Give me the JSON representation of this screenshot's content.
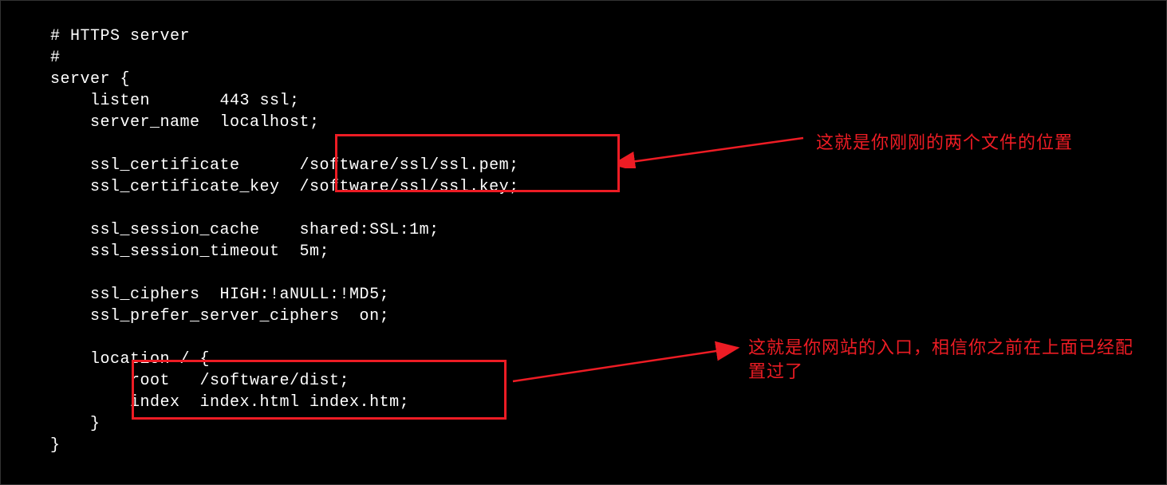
{
  "code": {
    "line1": "# HTTPS server",
    "line2": "#",
    "line3": "server {",
    "line4": "    listen       443 ssl;",
    "line5": "    server_name  localhost;",
    "line6": "",
    "line7": "    ssl_certificate      /software/ssl/ssl.pem;",
    "line8": "    ssl_certificate_key  /software/ssl/ssl.key;",
    "line9": "",
    "line10": "    ssl_session_cache    shared:SSL:1m;",
    "line11": "    ssl_session_timeout  5m;",
    "line12": "",
    "line13": "    ssl_ciphers  HIGH:!aNULL:!MD5;",
    "line14": "    ssl_prefer_server_ciphers  on;",
    "line15": "",
    "line16": "    location / {",
    "line17": "        root   /software/dist;",
    "line18": "        index  index.html index.htm;",
    "line19": "    }",
    "line20": "}"
  },
  "annotations": {
    "anno1": "这就是你刚刚的两个文件的位置",
    "anno2": "这就是你网站的入口，相信你之前在上面已经配置过了"
  }
}
